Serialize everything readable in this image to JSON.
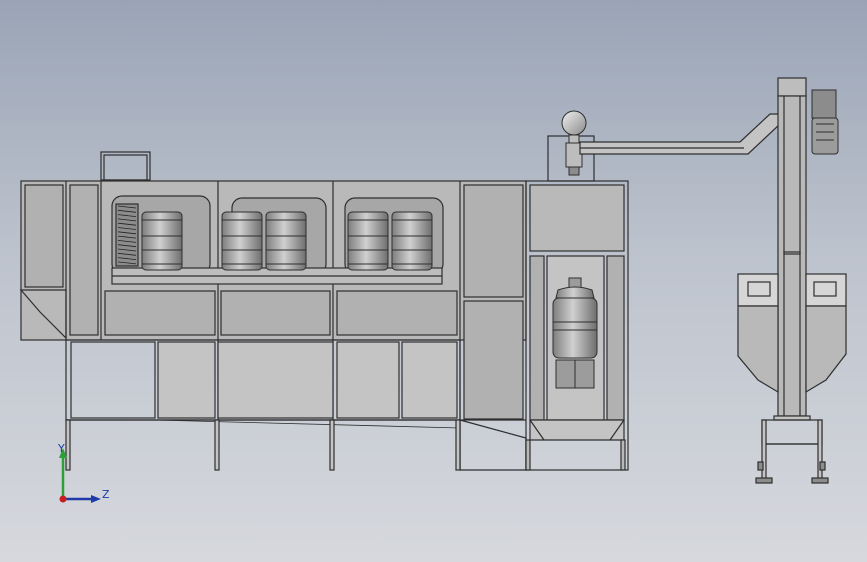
{
  "viewport": {
    "background_top": "#9aa4b6",
    "background_bottom": "#d6d8dd"
  },
  "colors": {
    "machine_body": "#b9b9b9",
    "panel": "#b1b1b1",
    "window": "#a7a7a7",
    "outline": "#2e2e2e",
    "bottle": "#9c9c9c",
    "frame": "#c4c4c4"
  },
  "triad": {
    "y_label": "Y",
    "z_label": "Z",
    "y_color": "#2e9e38",
    "z_color": "#1f3aa8",
    "origin_color": "#c81e1e"
  },
  "components": [
    "washing-machine-body",
    "washing-windows",
    "bottles-in-washer",
    "filling-capping-station",
    "capper-head",
    "cap-chute",
    "cap-elevator-column",
    "cap-hopper",
    "motor"
  ]
}
